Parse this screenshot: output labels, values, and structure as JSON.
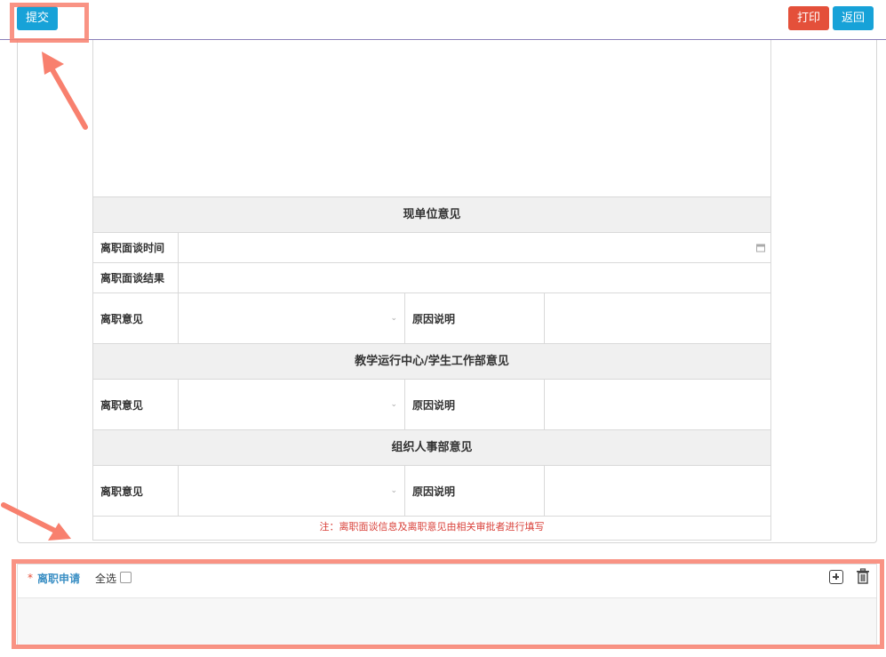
{
  "toolbar": {
    "submit_label": "提交",
    "print_label": "打印",
    "return_label": "返回"
  },
  "colors": {
    "primary_blue": "#17a2d8",
    "danger_red": "#e4503a",
    "annotation_salmon": "#f8806e",
    "note_red": "#d9413a"
  },
  "form": {
    "current_unit": {
      "title": "现单位意见",
      "interview_time_label": "离职面谈时间",
      "interview_time_value": "",
      "interview_result_label": "离职面谈结果",
      "interview_result_value": "",
      "opinion_label": "离职意见",
      "opinion_value": "",
      "reason_label": "原因说明",
      "reason_value": ""
    },
    "teaching_center": {
      "title": "教学运行中心/学生工作部意见",
      "opinion_label": "离职意见",
      "opinion_value": "",
      "reason_label": "原因说明",
      "reason_value": ""
    },
    "hr_department": {
      "title": "组织人事部意见",
      "opinion_label": "离职意见",
      "opinion_value": "",
      "reason_label": "原因说明",
      "reason_value": ""
    },
    "note": "注：离职面谈信息及离职意见由相关审批者进行填写"
  },
  "application": {
    "required_mark": "*",
    "title": "离职申请",
    "select_all_label": "全选",
    "select_all_checked": false,
    "icons": [
      "add-square-icon",
      "trash-icon"
    ]
  }
}
